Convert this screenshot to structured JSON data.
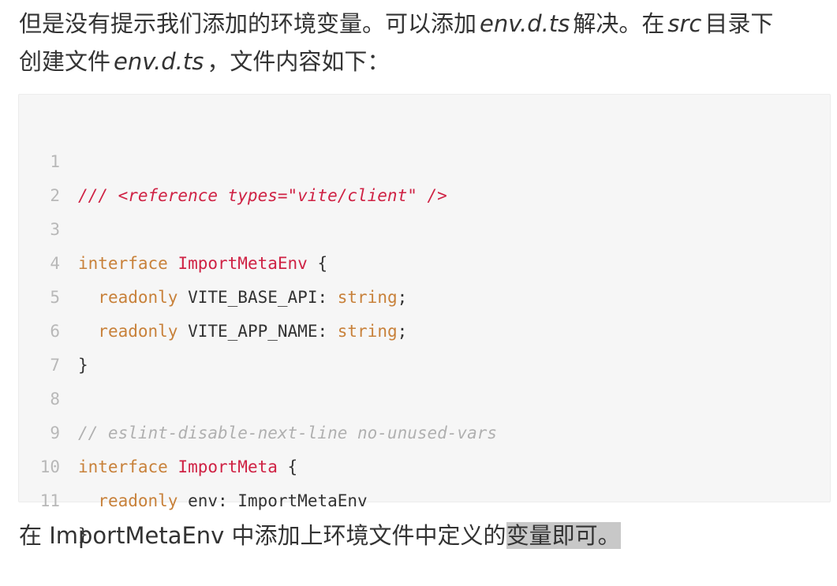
{
  "para_top": {
    "line1_part1": "但是没有提示我们添加的环境变量。可以添加",
    "line1_code1": "env.d.ts",
    "line1_part2": "解决。在",
    "line1_code2": "src",
    "line1_part3": "目录下",
    "line2_part1": "创建文件",
    "line2_code1": "env.d.ts",
    "line2_part2": "，文件内容如下："
  },
  "code_block": {
    "lines": [
      {
        "num": "1",
        "ref": "/// <reference types=\"vite/client\" />"
      },
      {
        "num": "2"
      },
      {
        "num": "3",
        "kw": "interface",
        "sp": " ",
        "type": "ImportMetaEnv",
        "rest": " {"
      },
      {
        "num": "4",
        "indent": "  ",
        "kw": "readonly",
        "rest": " VITE_BASE_API: ",
        "kw2": "string",
        "tail": ";"
      },
      {
        "num": "5",
        "indent": "  ",
        "kw": "readonly",
        "rest": " VITE_APP_NAME: ",
        "kw2": "string",
        "tail": ";"
      },
      {
        "num": "6",
        "rest": "}"
      },
      {
        "num": "7"
      },
      {
        "num": "8",
        "comment": "// eslint-disable-next-line no-unused-vars"
      },
      {
        "num": "9",
        "kw": "interface",
        "sp": " ",
        "type": "ImportMeta",
        "rest": " {"
      },
      {
        "num": "10",
        "indent": "  ",
        "kw": "readonly",
        "rest": " env: ImportMetaEnv"
      },
      {
        "num": "11",
        "rest": "}"
      }
    ]
  },
  "para_bottom": {
    "part1": "在 ImportMetaEnv 中添加上环境文件中定义的",
    "selected": "变量即可。"
  }
}
